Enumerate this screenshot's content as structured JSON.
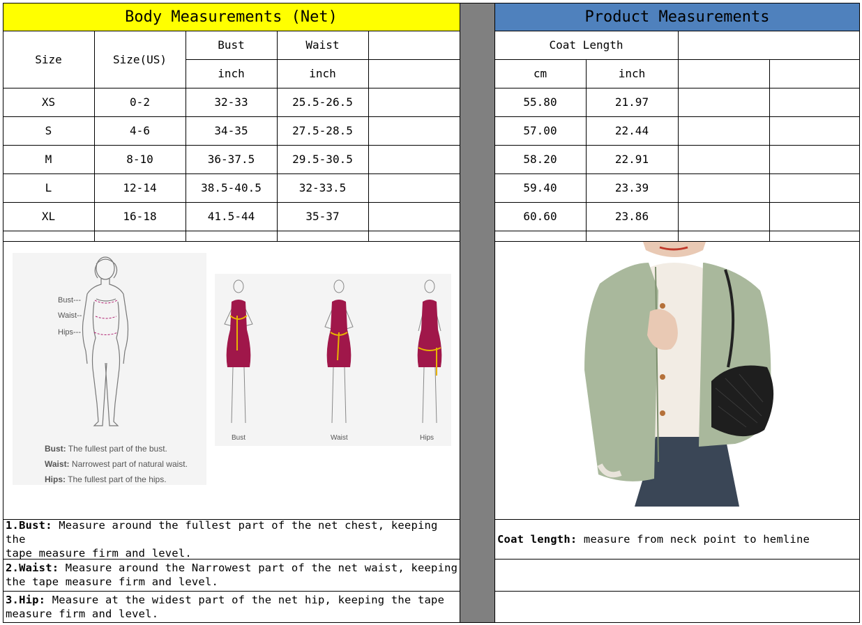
{
  "body_header": "Body Measurements (Net)",
  "product_header": "Product Measurements",
  "body_table": {
    "col_size": "Size",
    "col_size_us": "Size(US)",
    "col_bust": "Bust",
    "col_waist": "Waist",
    "unit_bust": "inch",
    "unit_waist": "inch",
    "rows": [
      {
        "size": "XS",
        "us": "0-2",
        "bust": "32-33",
        "waist": "25.5-26.5"
      },
      {
        "size": "S",
        "us": "4-6",
        "bust": "34-35",
        "waist": "27.5-28.5"
      },
      {
        "size": "M",
        "us": "8-10",
        "bust": "36-37.5",
        "waist": "29.5-30.5"
      },
      {
        "size": "L",
        "us": "12-14",
        "bust": "38.5-40.5",
        "waist": "32-33.5"
      },
      {
        "size": "XL",
        "us": "16-18",
        "bust": "41.5-44",
        "waist": "35-37"
      }
    ]
  },
  "product_table": {
    "col_coat_length": "Coat Length",
    "unit_cm": "cm",
    "unit_inch": "inch",
    "rows": [
      {
        "cm": "55.80",
        "inch": "21.97"
      },
      {
        "cm": "57.00",
        "inch": "22.44"
      },
      {
        "cm": "58.20",
        "inch": "22.91"
      },
      {
        "cm": "59.40",
        "inch": "23.39"
      },
      {
        "cm": "60.60",
        "inch": "23.86"
      }
    ]
  },
  "diagram": {
    "label_bust": "Bust---",
    "label_waist": "Waist--",
    "label_hips": "Hips---",
    "def_bust_term": "Bust:",
    "def_bust_text": "The fullest part of the bust.",
    "def_waist_term": "Waist:",
    "def_waist_text": "Narrowest part of natural waist.",
    "def_hips_term": "Hips:",
    "def_hips_text": "The fullest part of the hips.",
    "caption_bust": "Bust",
    "caption_waist": "Waist",
    "caption_hips": "Hips"
  },
  "notes": {
    "bust_term": "1.Bust:",
    "bust_text_1": " Measure around the fullest part of the net chest, keeping the",
    "bust_text_2": "tape  measure firm and level.",
    "waist_term": "2.Waist:",
    "waist_text_1": " Measure around the Narrowest part of the net waist, keeping",
    "waist_text_2": "the tape  measure firm and level.",
    "hip_term": "3.Hip:",
    "hip_text_1": " Measure at the widest part of the net hip, keeping the tape",
    "hip_text_2": "measure firm and level.",
    "coat_term": "Coat length:",
    "coat_text": " measure from neck point to hemline"
  },
  "colors": {
    "body_header_bg": "#ffff00",
    "product_header_bg": "#4f81bd",
    "separator": "#808080",
    "dress": "#a0174a",
    "tape": "#e8b400",
    "jacket": "#a9b89c"
  }
}
